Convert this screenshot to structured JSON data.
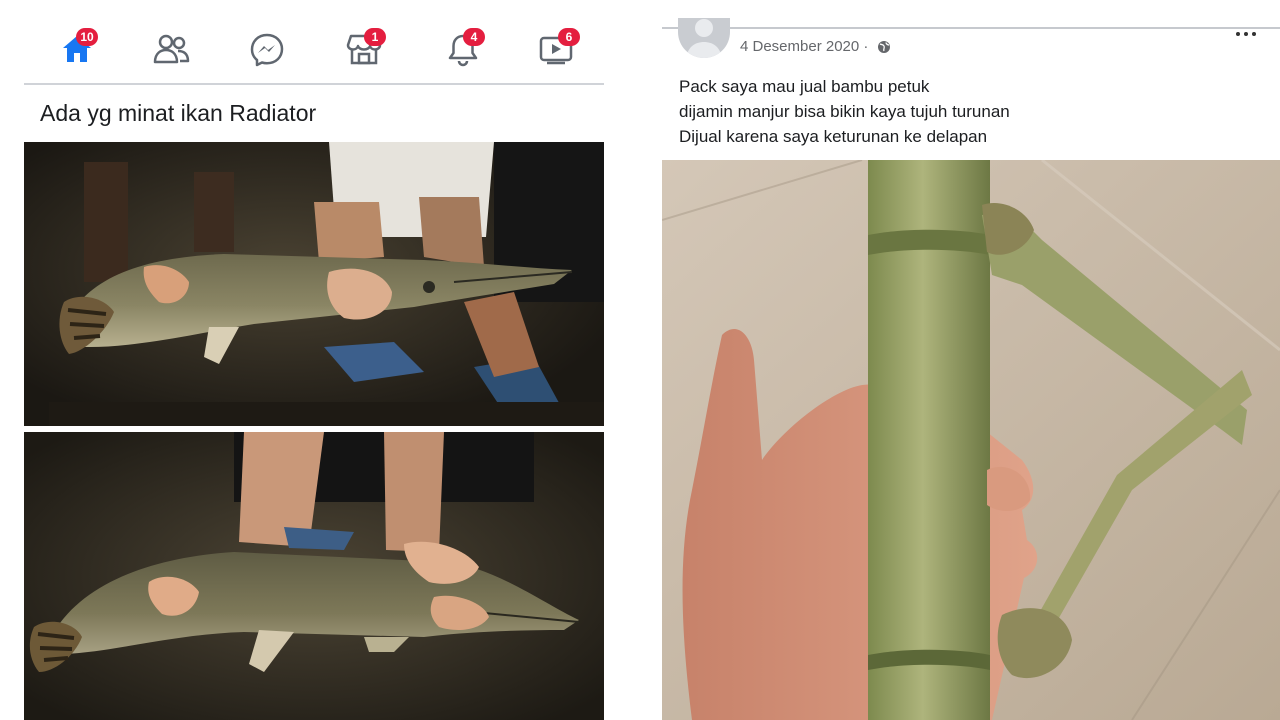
{
  "left_post": {
    "nav": {
      "home_badge": "10",
      "marketplace_badge": "1",
      "notifications_badge": "4",
      "watch_badge": "6"
    },
    "text": "Ada yg minat ikan Radiator"
  },
  "right_post": {
    "date": "4 Desember 2020",
    "separator": "·",
    "caption_lines": [
      "Pack saya mau jual bambu petuk",
      "dijamin manjur bisa bikin kaya tujuh turunan",
      "Dijual karena saya keturunan ke delapan"
    ]
  },
  "colors": {
    "home_blue": "#1877f2",
    "badge_red": "#e41e3f",
    "icon_gray": "#606770"
  }
}
